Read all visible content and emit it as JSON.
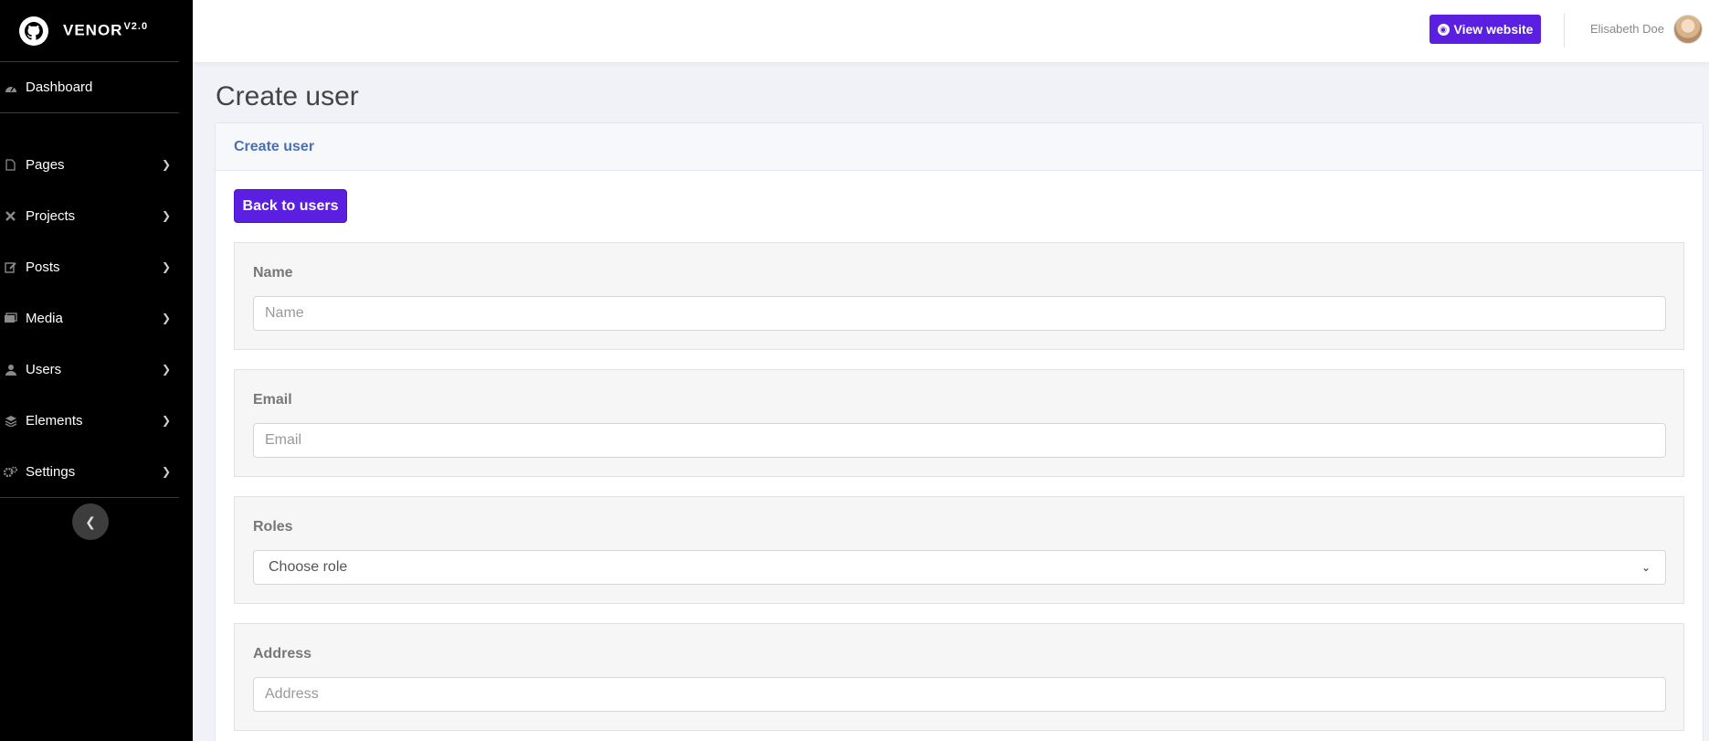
{
  "brand": {
    "name": "VENOR",
    "version": "V2.0"
  },
  "sidebar": {
    "dashboard": {
      "label": "Dashboard",
      "icon": "gauge-icon"
    },
    "items": [
      {
        "label": "Pages",
        "icon": "file-icon"
      },
      {
        "label": "Projects",
        "icon": "tools-icon"
      },
      {
        "label": "Posts",
        "icon": "edit-icon"
      },
      {
        "label": "Media",
        "icon": "images-icon"
      },
      {
        "label": "Users",
        "icon": "user-icon"
      },
      {
        "label": "Elements",
        "icon": "layers-icon"
      },
      {
        "label": "Settings",
        "icon": "cogs-icon"
      }
    ],
    "collapse_icon": "chevron-left-icon"
  },
  "topbar": {
    "view_website_label": "View website",
    "user_name": "Elisabeth Doe"
  },
  "main": {
    "page_title": "Create user",
    "card_title": "Create user",
    "back_label": "Back to users",
    "fields": {
      "name": {
        "label": "Name",
        "placeholder": "Name"
      },
      "email": {
        "label": "Email",
        "placeholder": "Email"
      },
      "roles": {
        "label": "Roles",
        "selected": "Choose role"
      },
      "address": {
        "label": "Address",
        "placeholder": "Address"
      }
    }
  },
  "colors": {
    "accent": "#5a1fe0",
    "sidebar_bg": "#000000",
    "card_header_text": "#4a6fb5"
  }
}
